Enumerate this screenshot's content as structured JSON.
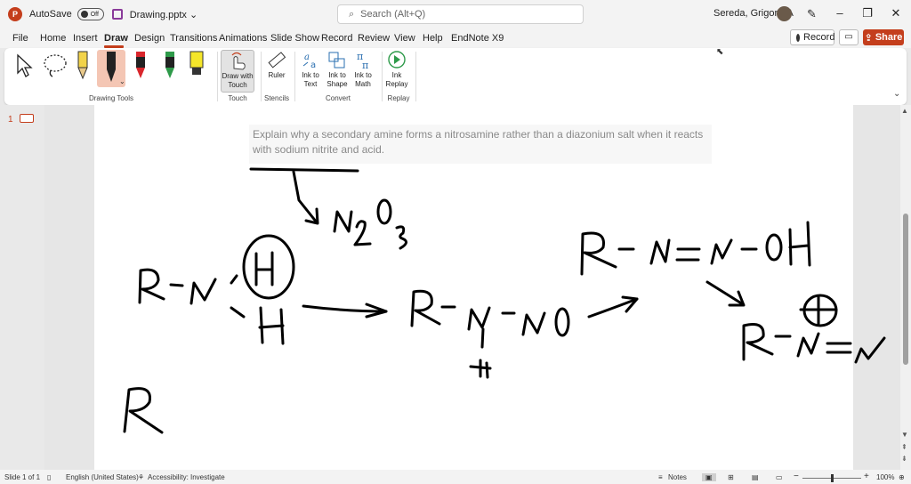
{
  "titlebar": {
    "autosave_label": "AutoSave",
    "autosave_state": "Off",
    "file_name": "Drawing.pptx",
    "search_placeholder": "Search (Alt+Q)",
    "user_name": "Sereda, Grigoriy A"
  },
  "menu": {
    "items": [
      "File",
      "Home",
      "Insert",
      "Draw",
      "Design",
      "Transitions",
      "Animations",
      "Slide Show",
      "Record",
      "Review",
      "View",
      "Help",
      "EndNote X9"
    ],
    "active": "Draw",
    "record_label": "Record",
    "share_label": "Share"
  },
  "ribbon": {
    "groups": {
      "drawing_tools": "Drawing Tools",
      "touch": "Touch",
      "stencils": "Stencils",
      "convert": "Convert",
      "replay": "Replay"
    },
    "buttons": {
      "draw_with_touch": "Draw with Touch",
      "ruler": "Ruler",
      "ink_to_text": "Ink to Text",
      "ink_to_shape": "Ink to Shape",
      "ink_to_math": "Ink to Math",
      "ink_replay": "Ink Replay"
    },
    "pen_colors": [
      "#f2d34a",
      "#222222",
      "#d9262c",
      "#2e9a4a",
      "#f5e62a"
    ]
  },
  "slides": {
    "current_number": "1"
  },
  "slide": {
    "prompt": "Explain why a secondary amine forms a nitrosamine rather than a diazonium salt when it reacts with sodium nitrite and acid."
  },
  "status": {
    "slide_info": "Slide 1 of 1",
    "language": "English (United States)",
    "accessibility": "Accessibility: Investigate",
    "notes": "Notes",
    "zoom": "100%"
  }
}
